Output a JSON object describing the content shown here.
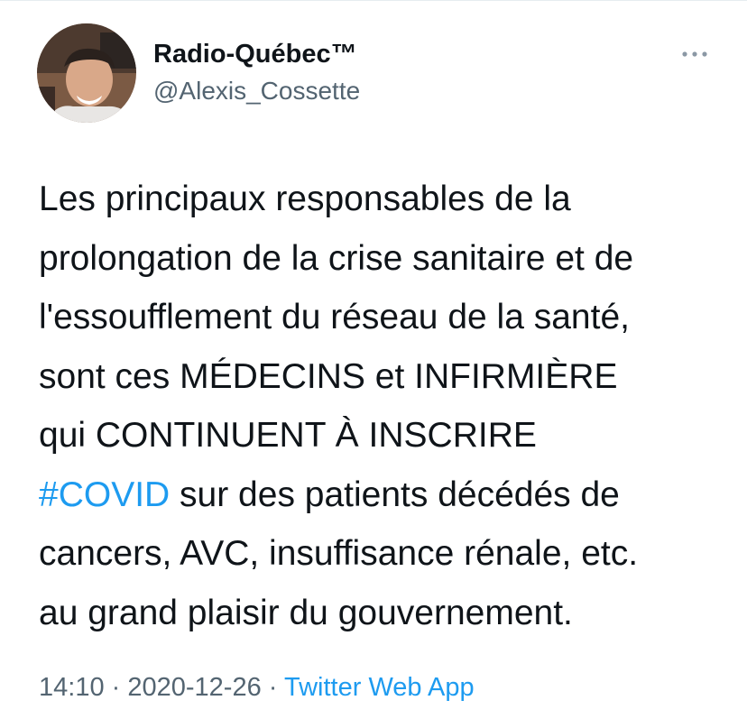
{
  "author": {
    "display_name": "Radio-Québec™",
    "handle": "@Alexis_Cossette"
  },
  "tweet": {
    "lines": [
      "Les principaux responsables de la",
      "prolongation de la crise sanitaire et de",
      "l'essoufflement du réseau de la santé,",
      "sont ces MÉDECINS et INFIRMIÈRE",
      "qui CONTINUENT À INSCRIRE",
      "sur des patients décédés de",
      "cancers, AVC, insuffisance rénale, etc.",
      "au grand plaisir du gouvernement."
    ],
    "hashtag": "#COVID"
  },
  "meta": {
    "time": "14:10",
    "separator": "·",
    "date": "2020-12-26",
    "source": "Twitter Web App"
  },
  "icons": {
    "avatar": "profile-photo",
    "more": "more-options-icon"
  },
  "colors": {
    "link_blue": "#1d9bf0",
    "text_primary": "#0f1419",
    "text_secondary": "#536471"
  }
}
